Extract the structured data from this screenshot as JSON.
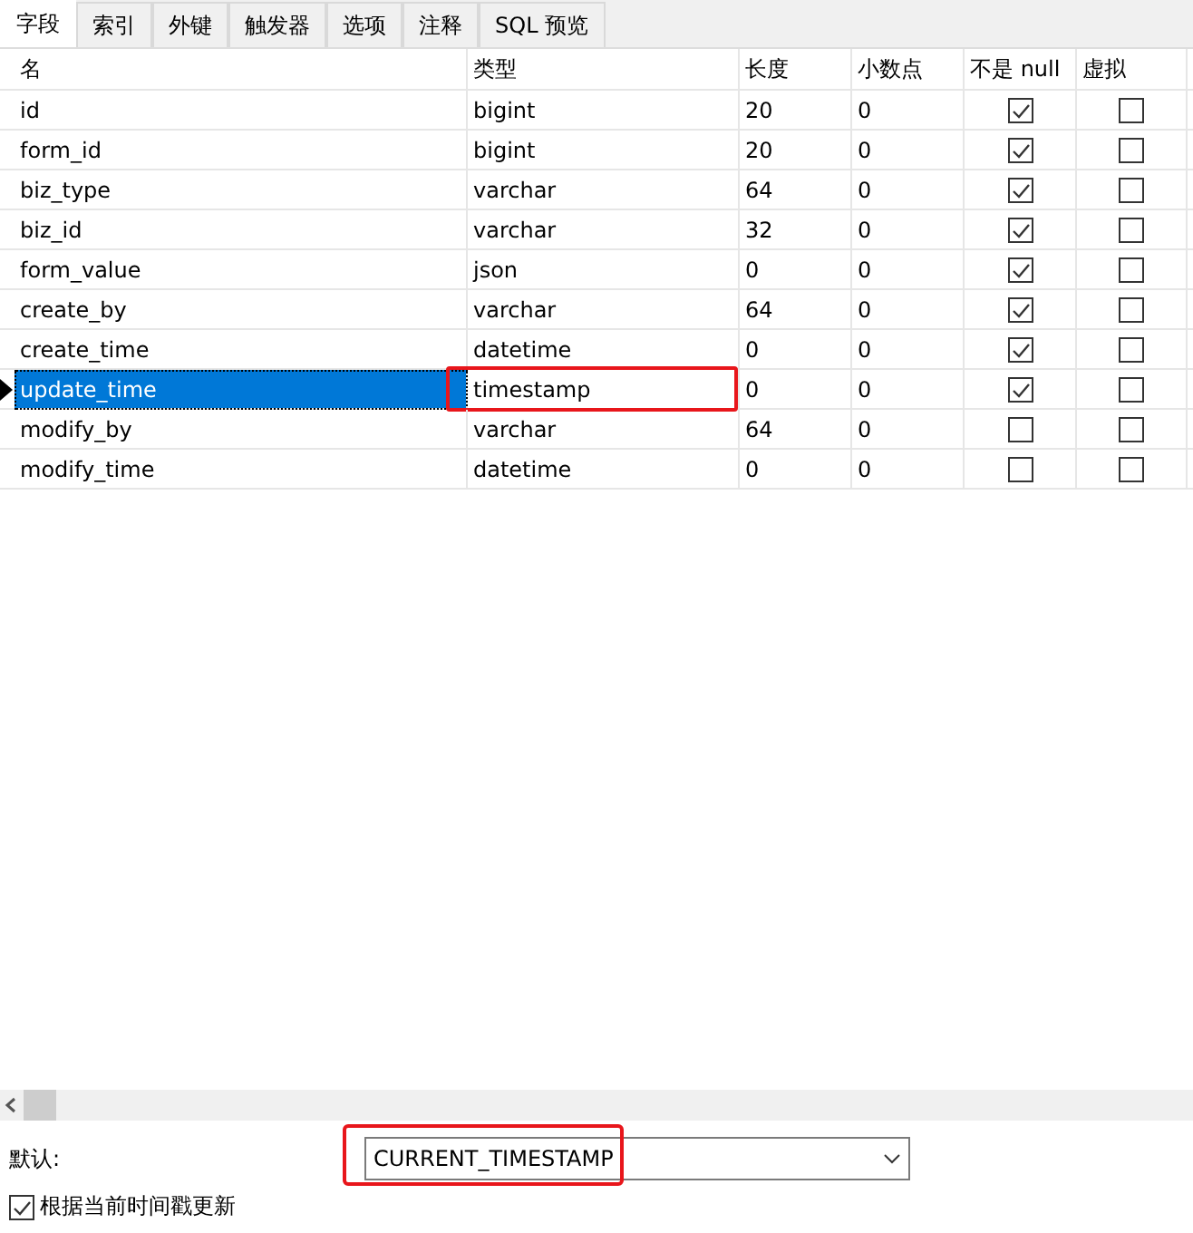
{
  "tabs": [
    {
      "label": "字段",
      "selected": true
    },
    {
      "label": "索引",
      "selected": false
    },
    {
      "label": "外键",
      "selected": false
    },
    {
      "label": "触发器",
      "selected": false
    },
    {
      "label": "选项",
      "selected": false
    },
    {
      "label": "注释",
      "selected": false
    },
    {
      "label": "SQL 预览",
      "selected": false
    }
  ],
  "table": {
    "columns": [
      "名",
      "类型",
      "长度",
      "小数点",
      "不是 null",
      "虚拟"
    ],
    "rows": [
      {
        "name": "id",
        "type": "bigint",
        "length": "20",
        "decimals": "0",
        "not_null": true,
        "virtual": false,
        "selected": false,
        "type_annotated": false
      },
      {
        "name": "form_id",
        "type": "bigint",
        "length": "20",
        "decimals": "0",
        "not_null": true,
        "virtual": false,
        "selected": false,
        "type_annotated": false
      },
      {
        "name": "biz_type",
        "type": "varchar",
        "length": "64",
        "decimals": "0",
        "not_null": true,
        "virtual": false,
        "selected": false,
        "type_annotated": false
      },
      {
        "name": "biz_id",
        "type": "varchar",
        "length": "32",
        "decimals": "0",
        "not_null": true,
        "virtual": false,
        "selected": false,
        "type_annotated": false
      },
      {
        "name": "form_value",
        "type": "json",
        "length": "0",
        "decimals": "0",
        "not_null": true,
        "virtual": false,
        "selected": false,
        "type_annotated": false
      },
      {
        "name": "create_by",
        "type": "varchar",
        "length": "64",
        "decimals": "0",
        "not_null": true,
        "virtual": false,
        "selected": false,
        "type_annotated": false
      },
      {
        "name": "create_time",
        "type": "datetime",
        "length": "0",
        "decimals": "0",
        "not_null": true,
        "virtual": false,
        "selected": false,
        "type_annotated": false
      },
      {
        "name": "update_time",
        "type": "timestamp",
        "length": "0",
        "decimals": "0",
        "not_null": true,
        "virtual": false,
        "selected": true,
        "type_annotated": true
      },
      {
        "name": "modify_by",
        "type": "varchar",
        "length": "64",
        "decimals": "0",
        "not_null": false,
        "virtual": false,
        "selected": false,
        "type_annotated": false
      },
      {
        "name": "modify_time",
        "type": "datetime",
        "length": "0",
        "decimals": "0",
        "not_null": false,
        "virtual": false,
        "selected": false,
        "type_annotated": false
      }
    ]
  },
  "default": {
    "label": "默认:",
    "value": "CURRENT_TIMESTAMP",
    "annotated": true
  },
  "on_update": {
    "label": "根据当前时间戳更新",
    "checked": true
  }
}
